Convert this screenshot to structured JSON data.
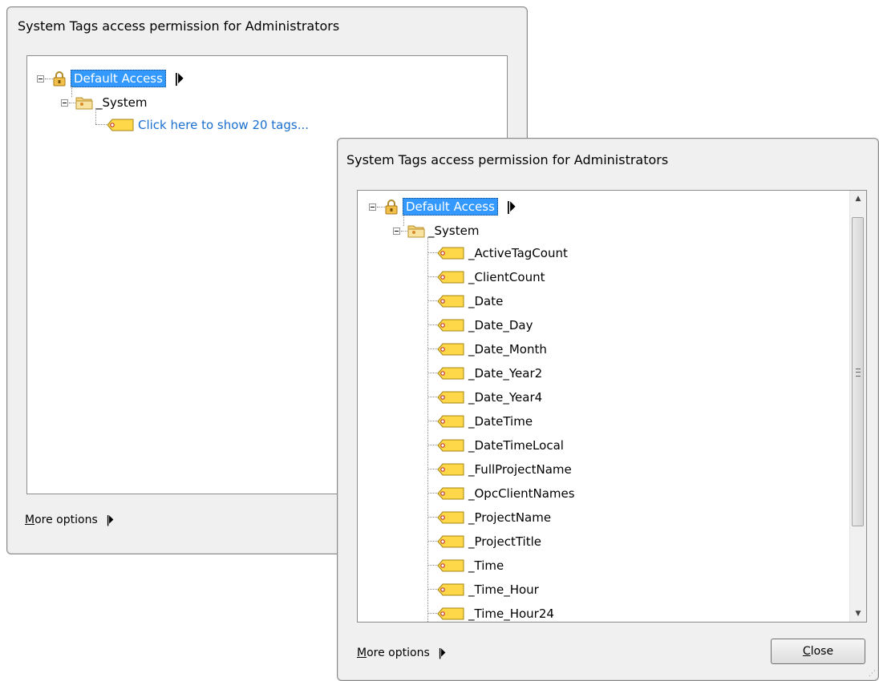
{
  "dialog_back": {
    "title": "System Tags access permission for Administrators",
    "tree": {
      "root_label": "Default Access",
      "root_more_glyph": "⏵",
      "folder_label": "_System",
      "link_label": "Click here to show 20 tags..."
    },
    "more_options": "More options",
    "more_options_access_key": "M",
    "more_options_rest": "ore options",
    "more_glyph": "⏵"
  },
  "dialog_front": {
    "title": "System Tags access permission for Administrators",
    "tree": {
      "root_label": "Default Access",
      "root_more_glyph": "⏵",
      "folder_label": "_System",
      "tags": [
        "_ActiveTagCount",
        "_ClientCount",
        "_Date",
        "_Date_Day",
        "_Date_Month",
        "_Date_Year2",
        "_Date_Year4",
        "_DateTime",
        "_DateTimeLocal",
        "_FullProjectName",
        "_OpcClientNames",
        "_ProjectName",
        "_ProjectTitle",
        "_Time",
        "_Time_Hour",
        "_Time_Hour24"
      ]
    },
    "more_options_access_key": "M",
    "more_options_rest": "ore options",
    "more_glyph": "⏵",
    "close_button": "Close",
    "close_access_key": "C",
    "close_rest": "lose"
  },
  "icons": {
    "lock": "lock-icon",
    "folder": "folder-icon",
    "tag": "tag-icon"
  },
  "colors": {
    "selection": "#3399ff",
    "link": "#1a6fcf",
    "tag_fill": "#ffd84a",
    "folder_fill": "#f5d77e"
  }
}
